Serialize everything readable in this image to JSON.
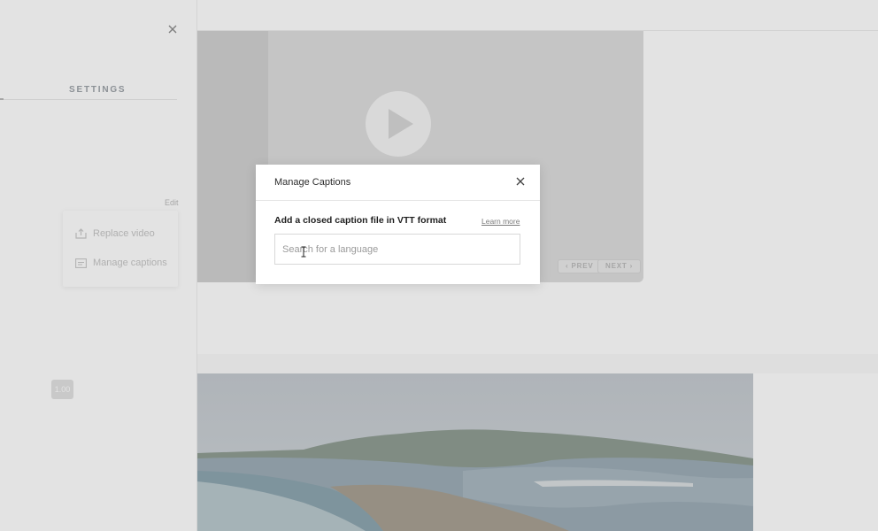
{
  "settings_panel": {
    "title": "SETTINGS",
    "edit_label": "Edit",
    "menu": [
      {
        "label": "Replace video",
        "icon": "upload-icon"
      },
      {
        "label": "Manage captions",
        "icon": "captions-icon"
      }
    ],
    "zoom_value": "1.00",
    "close_icon": "close-icon"
  },
  "video": {
    "play_icon": "play-icon",
    "prev_label": "PREV",
    "next_label": "NEXT"
  },
  "dialog": {
    "title": "Manage Captions",
    "instruction": "Add a closed caption file in VTT format",
    "learn_more": "Learn more",
    "search": {
      "placeholder": "Search for a language",
      "value": ""
    },
    "close_icon": "close-icon"
  },
  "colors": {
    "overlay": "#3c3c3c",
    "dialog_bg": "#ffffff",
    "text_primary": "#1f1f1f",
    "muted": "#9aa0a6"
  }
}
